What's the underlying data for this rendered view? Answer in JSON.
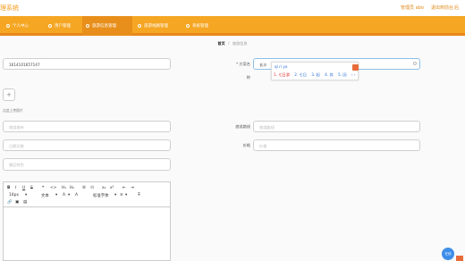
{
  "header": {
    "app_title": "理系统",
    "admin_user": "管理员 abo",
    "logout": "退出到前台",
    "site_link": "后"
  },
  "nav": {
    "items": [
      {
        "label": "个人中心"
      },
      {
        "label": "用户管理"
      },
      {
        "label": "旅游信息管理"
      },
      {
        "label": "旅游线路管理"
      },
      {
        "label": "系统管理"
      }
    ]
  },
  "breadcrumb": {
    "home": "首页",
    "separator": "/",
    "current": "旅游信息"
  },
  "form": {
    "number_value": "1614101657147",
    "place_label": "* 方案名",
    "place_value": "长沙",
    "partial_label": "称",
    "upload_plus": "+",
    "upload_hint": "点此上传照片",
    "city_placeholder": "旅游城市",
    "route_label": "旅游路线",
    "route_placeholder": "旅游路线",
    "date_placeholder": "日期天数",
    "price_label": "价格",
    "price_placeholder": "价格",
    "desc_placeholder": "景区特色"
  },
  "ime": {
    "pinyin": "qi ri yo",
    "candidates": [
      "1. 七日游",
      "2. 七日",
      "3. 起",
      "4. 其",
      "5. 因"
    ],
    "more": "‹ ›"
  },
  "editor": {
    "row1": [
      "B",
      "I",
      "U",
      "S",
      "❝",
      "<>",
      "H₁",
      "H₂",
      "☰",
      "☷",
      "x₂",
      "x²",
      "⇤",
      "⇥"
    ],
    "row2": [
      "14px",
      "▾",
      "文本",
      "▾",
      "A",
      "▾",
      "A",
      "标准字体",
      "▾",
      "≡",
      "▾",
      "T̶"
    ],
    "row3": [
      "🔗",
      "▣",
      "▤"
    ]
  },
  "chat": {
    "label": "在线"
  },
  "colors": {
    "accent": "#f5a623",
    "accent_dark": "#e88f1b",
    "link": "#2a6fd6"
  }
}
